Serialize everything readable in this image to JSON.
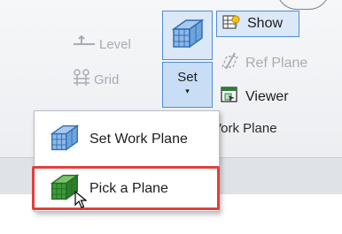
{
  "ribbon": {
    "level_label": "Level",
    "grid_label": "Grid",
    "set_label": "Set",
    "set_caret": "▾",
    "show_label": "Show",
    "ref_plane_label": "Ref Plane",
    "viewer_label": "Viewer",
    "group_label_fragment": "Vork Plane"
  },
  "menu": {
    "items": [
      {
        "label": "Set Work Plane",
        "icon": "work-plane-icon"
      },
      {
        "label": "Pick a Plane",
        "icon": "pick-plane-icon"
      }
    ]
  },
  "colors": {
    "accent_blue": "#4f8cd6",
    "highlight_red": "#e0403a",
    "disabled_gray": "#a8acb3"
  }
}
